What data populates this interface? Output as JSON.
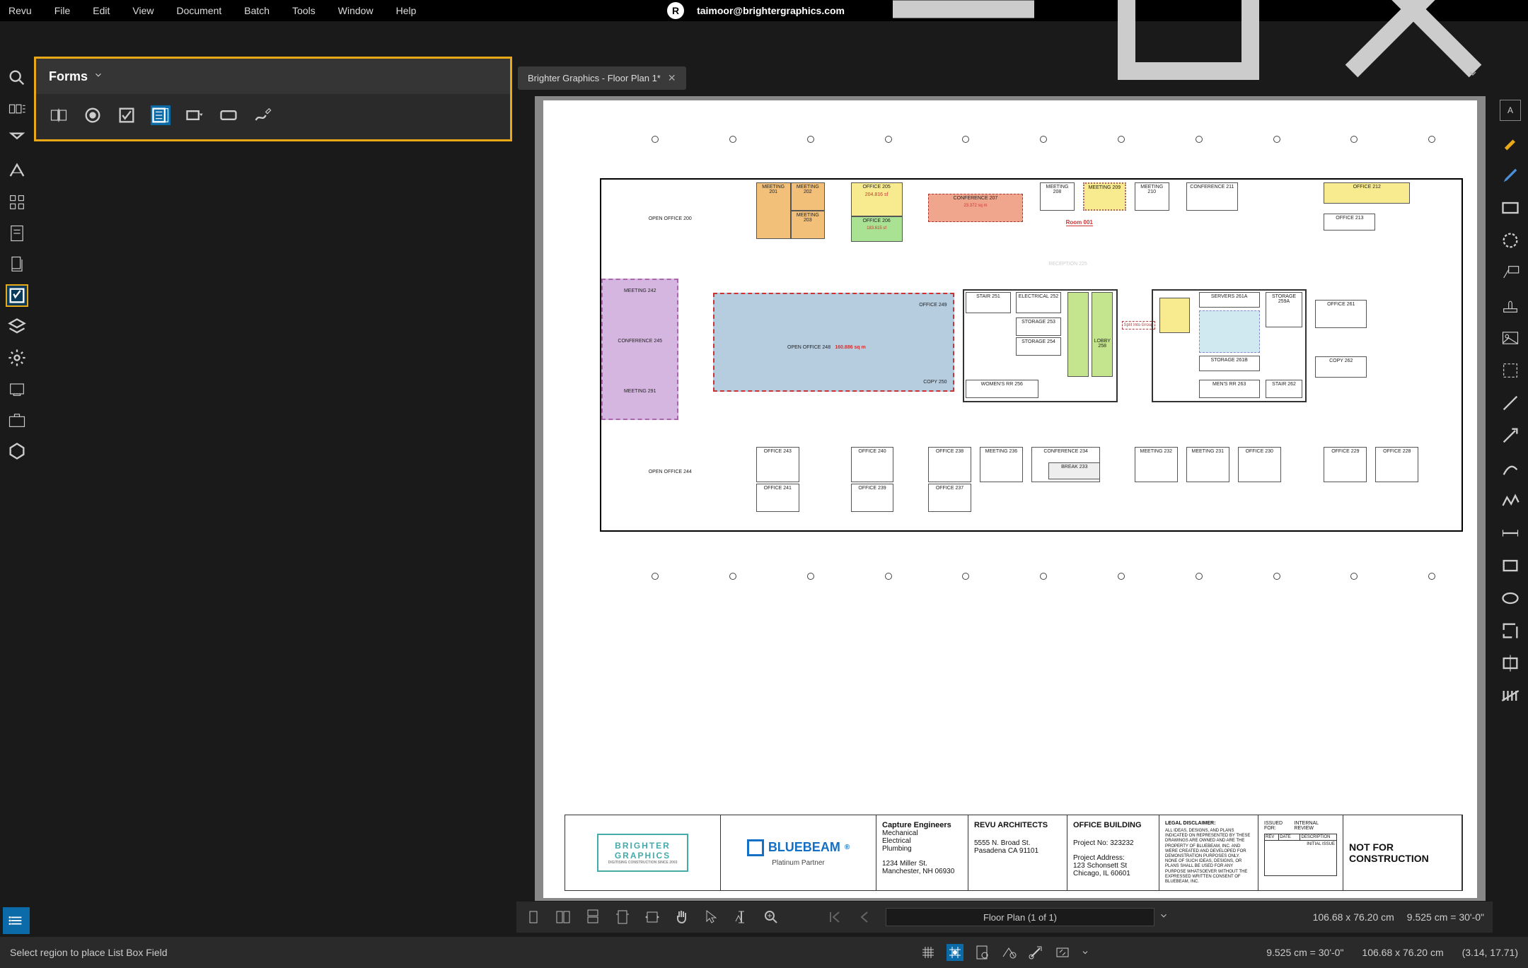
{
  "menu": {
    "items": [
      "Revu",
      "File",
      "Edit",
      "View",
      "Document",
      "Batch",
      "Tools",
      "Window",
      "Help"
    ],
    "user_email": "taimoor@brightergraphics.com"
  },
  "forms_panel": {
    "title": "Forms"
  },
  "tab": {
    "title": "Brighter Graphics - Floor Plan 1*"
  },
  "right_rail_top": "A",
  "floorplan": {
    "rooms": [
      {
        "label": "OPEN OFFICE  200"
      },
      {
        "label": "MEETING  201"
      },
      {
        "label": "MEETING  202"
      },
      {
        "label": "MEETING  203"
      },
      {
        "label": "OFFICE  205"
      },
      {
        "label": "OFFICE  206"
      },
      {
        "label": "CONFERENCE  207"
      },
      {
        "label": "MEETING  208"
      },
      {
        "label": "MEETING  209"
      },
      {
        "label": "MEETING  210"
      },
      {
        "label": "CONFERENCE  211"
      },
      {
        "label": "OFFICE  212"
      },
      {
        "label": "OFFICE  213"
      },
      {
        "label": "RECEPTION  225"
      },
      {
        "label": "MEETING  242"
      },
      {
        "label": "CONFERENCE  245"
      },
      {
        "label": "MEETING  291"
      },
      {
        "label": "OFFICE  249"
      },
      {
        "label": "OPEN OFFICE  248"
      },
      {
        "label": "COPY  250"
      },
      {
        "label": "STAIR  251"
      },
      {
        "label": "ELECTRICAL  252"
      },
      {
        "label": "STORAGE  253"
      },
      {
        "label": "STORAGE  254"
      },
      {
        "label": "WOMEN'S RR  256"
      },
      {
        "label": "LOBBY  258"
      },
      {
        "label": "SERVERS  261A"
      },
      {
        "label": "STORAGE 261B"
      },
      {
        "label": "STORAGE 259A"
      },
      {
        "label": "MEN'S RR  263"
      },
      {
        "label": "STAIR  262"
      },
      {
        "label": "OFFICE  261"
      },
      {
        "label": "COPY  262"
      },
      {
        "label": "OPEN OFFICE  244"
      },
      {
        "label": "OFFICE  243"
      },
      {
        "label": "OFFICE  241"
      },
      {
        "label": "OFFICE  240"
      },
      {
        "label": "OFFICE  239"
      },
      {
        "label": "OFFICE  238"
      },
      {
        "label": "OFFICE  237"
      },
      {
        "label": "MEETING  236"
      },
      {
        "label": "CONFERENCE  234"
      },
      {
        "label": "BREAK  233"
      },
      {
        "label": "MEETING  232"
      },
      {
        "label": "MEETING  231"
      },
      {
        "label": "OFFICE  230"
      },
      {
        "label": "OFFICE  229"
      },
      {
        "label": "OFFICE  228"
      }
    ],
    "annotations": {
      "room001": "Room 001",
      "area_office205": "204.816 sf",
      "area_conf207": "23.372 sq m",
      "area_office206": "183.615 sf",
      "area_openoffice248": "160.886 sq m",
      "soft_link_group": "Split Into Group"
    }
  },
  "title_block": {
    "brighter": {
      "line1": "BRIGHTER",
      "line2": "GRAPHICS",
      "tagline": "DIGITISING CONSTRUCTION SINCE 2003"
    },
    "bluebeam": {
      "name": "BLUEBEAM",
      "partner": "Platinum Partner"
    },
    "capture": {
      "title": "Capture Engineers",
      "lines": [
        "Mechanical",
        "Electrical",
        "Plumbing"
      ],
      "addr1": "1234 Miller St.",
      "addr2": "Manchester, NH 06930"
    },
    "arch": {
      "title": "REVU ARCHITECTS",
      "addr1": "5555 N. Broad St.",
      "addr2": "Pasadena CA 91101"
    },
    "project": {
      "title": "OFFICE BUILDING",
      "proj_no": "Project No: 323232",
      "addr_label": "Project Address:",
      "addr1": "123 Schonsett St",
      "addr2": "Chicago, IL 60601"
    },
    "legal": {
      "title": "LEGAL DISCLAIMER:",
      "body": "ALL IDEAS, DESIGNS, AND PLANS INDICATED ON REPRESENTED BY THESE DRAWINGS ARE OWNED AND ARE THE PROPERTY OF BLUEBEAM, INC. AND WERE CREATED AND DEVELOPED FOR DEMONSTRATION PURPOSES ONLY. NONE OF SUCH IDEAS, DESIGNS, OR PLANS SHALL BE USED FOR ANY PURPOSE WHATSOEVER WITHOUT THE EXPRESSED WRITTEN CONSENT OF BLUEBEAM, INC."
    },
    "revisions": {
      "issued_for": "ISSUED FOR:",
      "internal_review": "INTERNAL REVIEW",
      "headers": [
        "REV",
        "DATE",
        "DESCRIPTION"
      ],
      "initial": "INITIAL ISSUE"
    },
    "notfor": "NOT FOR CONSTRUCTION"
  },
  "bottom_bar": {
    "page_label": "Floor Plan (1 of 1)",
    "dims": "106.68 x 76.20 cm",
    "scale": "9.525 cm = 30'-0\""
  },
  "status": {
    "message": "Select region to place List Box Field",
    "scale": "9.525 cm = 30'-0\"",
    "dims": "106.68 x 76.20 cm",
    "coords": "(3.14, 17.71)"
  }
}
